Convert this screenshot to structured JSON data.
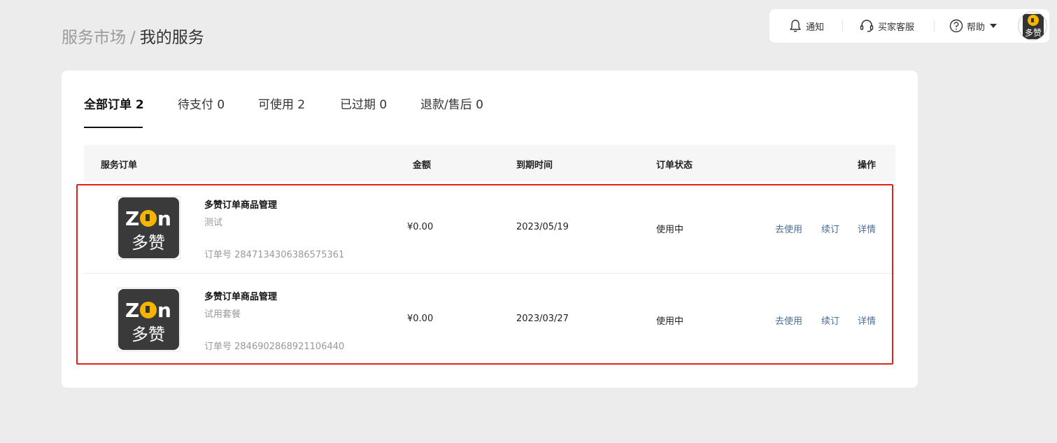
{
  "breadcrumb": {
    "parent": "服务市场",
    "separator": "/",
    "current": "我的服务"
  },
  "topbar": {
    "notify_label": "通知",
    "service_label": "买家客服",
    "help_label": "帮助"
  },
  "tabs": [
    {
      "label": "全部订单 2",
      "active": true
    },
    {
      "label": "待支付 0",
      "active": false
    },
    {
      "label": "可使用 2",
      "active": false
    },
    {
      "label": "已过期 0",
      "active": false
    },
    {
      "label": "退款/售后 0",
      "active": false
    }
  ],
  "table": {
    "headers": {
      "order": "服务订单",
      "amount": "金额",
      "expire": "到期时间",
      "status": "订单状态",
      "actions": "操作"
    },
    "rows": [
      {
        "name": "多赞订单商品管理",
        "desc": "测试",
        "order_no": "订单号 2847134306386575361",
        "amount": "¥0.00",
        "expire": "2023/05/19",
        "status": "使用中",
        "action_use": "去使用",
        "action_renew": "续订",
        "action_detail": "详情"
      },
      {
        "name": "多赞订单商品管理",
        "desc": "试用套餐",
        "order_no": "订单号 2846902868921106440",
        "amount": "¥0.00",
        "expire": "2023/03/27",
        "status": "使用中",
        "action_use": "去使用",
        "action_renew": "续订",
        "action_detail": "详情"
      }
    ]
  },
  "logo_text": "多赞",
  "colors": {
    "accent_highlight": "#e2211c",
    "link": "#4a6c96",
    "logo_yellow": "#f5b400"
  }
}
